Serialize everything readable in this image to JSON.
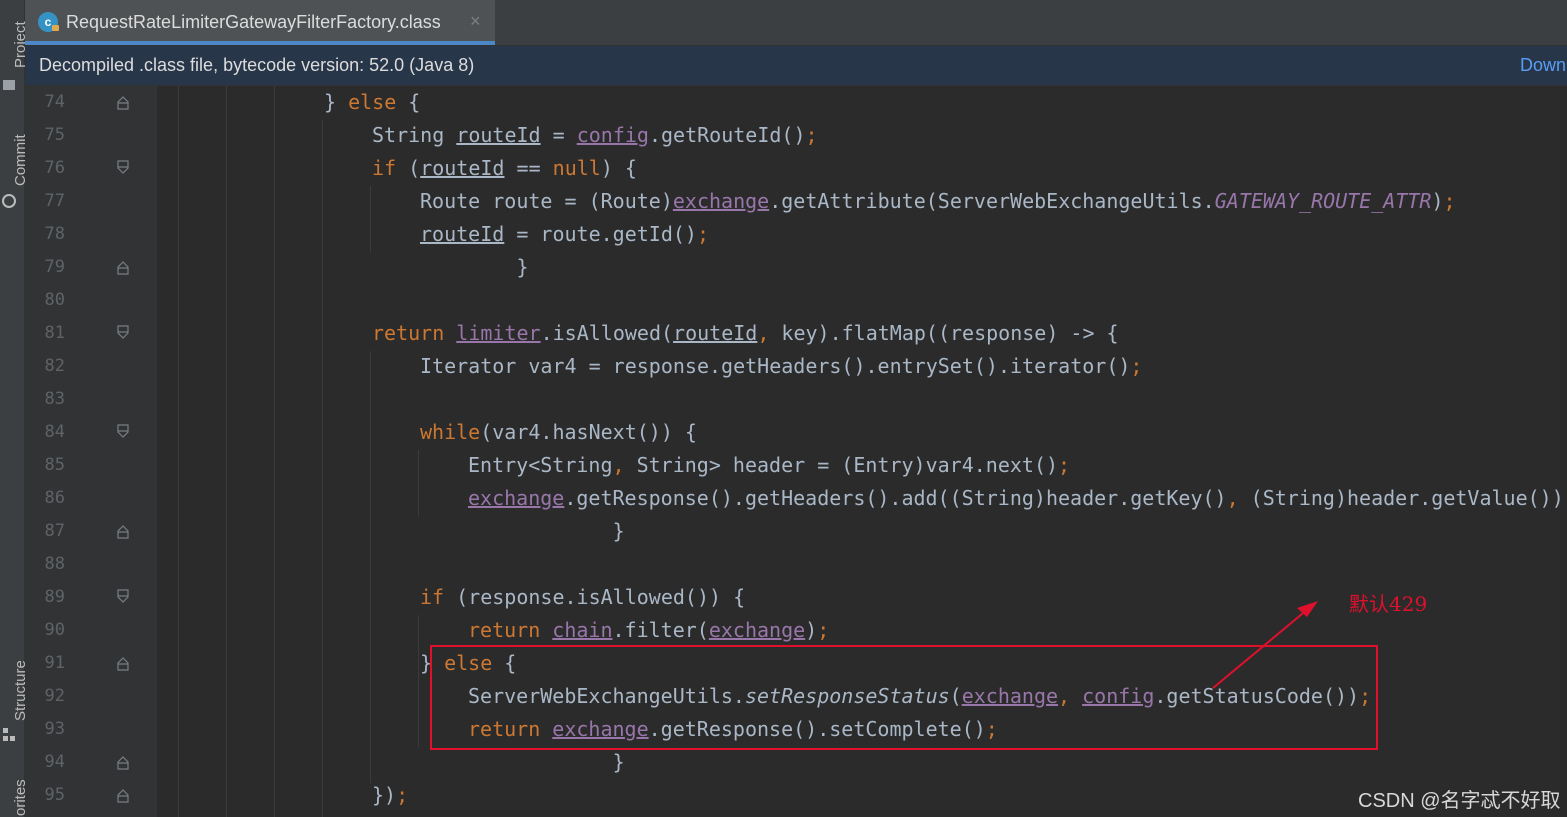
{
  "sidebar": {
    "items": [
      {
        "label": "Project",
        "icon": "folder-icon"
      },
      {
        "label": "Commit",
        "icon": "commit-icon"
      },
      {
        "label": "Structure",
        "icon": "structure-icon"
      },
      {
        "label": "orites",
        "icon": "star-icon"
      }
    ]
  },
  "tab": {
    "title": "RequestRateLimiterGatewayFilterFactory.class",
    "icon_letter": "c",
    "close": "×"
  },
  "banner": {
    "text": "Decompiled .class file, bytecode version: 52.0 (Java 8)",
    "link": "Down"
  },
  "code": {
    "lines": [
      {
        "n": "74",
        "text": "        } else {"
      },
      {
        "n": "75",
        "text": "            String routeId = config.getRouteId();"
      },
      {
        "n": "76",
        "text": "            if (routeId == null) {"
      },
      {
        "n": "77",
        "text": "                Route route = (Route)exchange.getAttribute(ServerWebExchangeUtils.GATEWAY_ROUTE_ATTR);"
      },
      {
        "n": "78",
        "text": "                routeId = route.getId();"
      },
      {
        "n": "79",
        "text": "            }"
      },
      {
        "n": "80",
        "text": ""
      },
      {
        "n": "81",
        "text": "            return limiter.isAllowed(routeId, key).flatMap((response) -> {"
      },
      {
        "n": "82",
        "text": "                Iterator var4 = response.getHeaders().entrySet().iterator();"
      },
      {
        "n": "83",
        "text": ""
      },
      {
        "n": "84",
        "text": "                while(var4.hasNext()) {"
      },
      {
        "n": "85",
        "text": "                    Entry<String, String> header = (Entry)var4.next();"
      },
      {
        "n": "86",
        "text": "                    exchange.getResponse().getHeaders().add((String)header.getKey(), (String)header.getValue());"
      },
      {
        "n": "87",
        "text": "                }"
      },
      {
        "n": "88",
        "text": ""
      },
      {
        "n": "89",
        "text": "                if (response.isAllowed()) {"
      },
      {
        "n": "90",
        "text": "                    return chain.filter(exchange);"
      },
      {
        "n": "91",
        "text": "                } else {"
      },
      {
        "n": "92",
        "text": "                    ServerWebExchangeUtils.setResponseStatus(exchange, config.getStatusCode());"
      },
      {
        "n": "93",
        "text": "                    return exchange.getResponse().setComplete();"
      },
      {
        "n": "94",
        "text": "                }"
      },
      {
        "n": "95",
        "text": "            });"
      }
    ]
  },
  "annotation": {
    "text": "默认429",
    "color": "#e0102d"
  },
  "watermark": "CSDN @名字忒不好取",
  "colors": {
    "keyword": "#cc7832",
    "field": "#9876aa",
    "text": "#a9b7c6",
    "line_number": "#606366",
    "link": "#589df6"
  }
}
